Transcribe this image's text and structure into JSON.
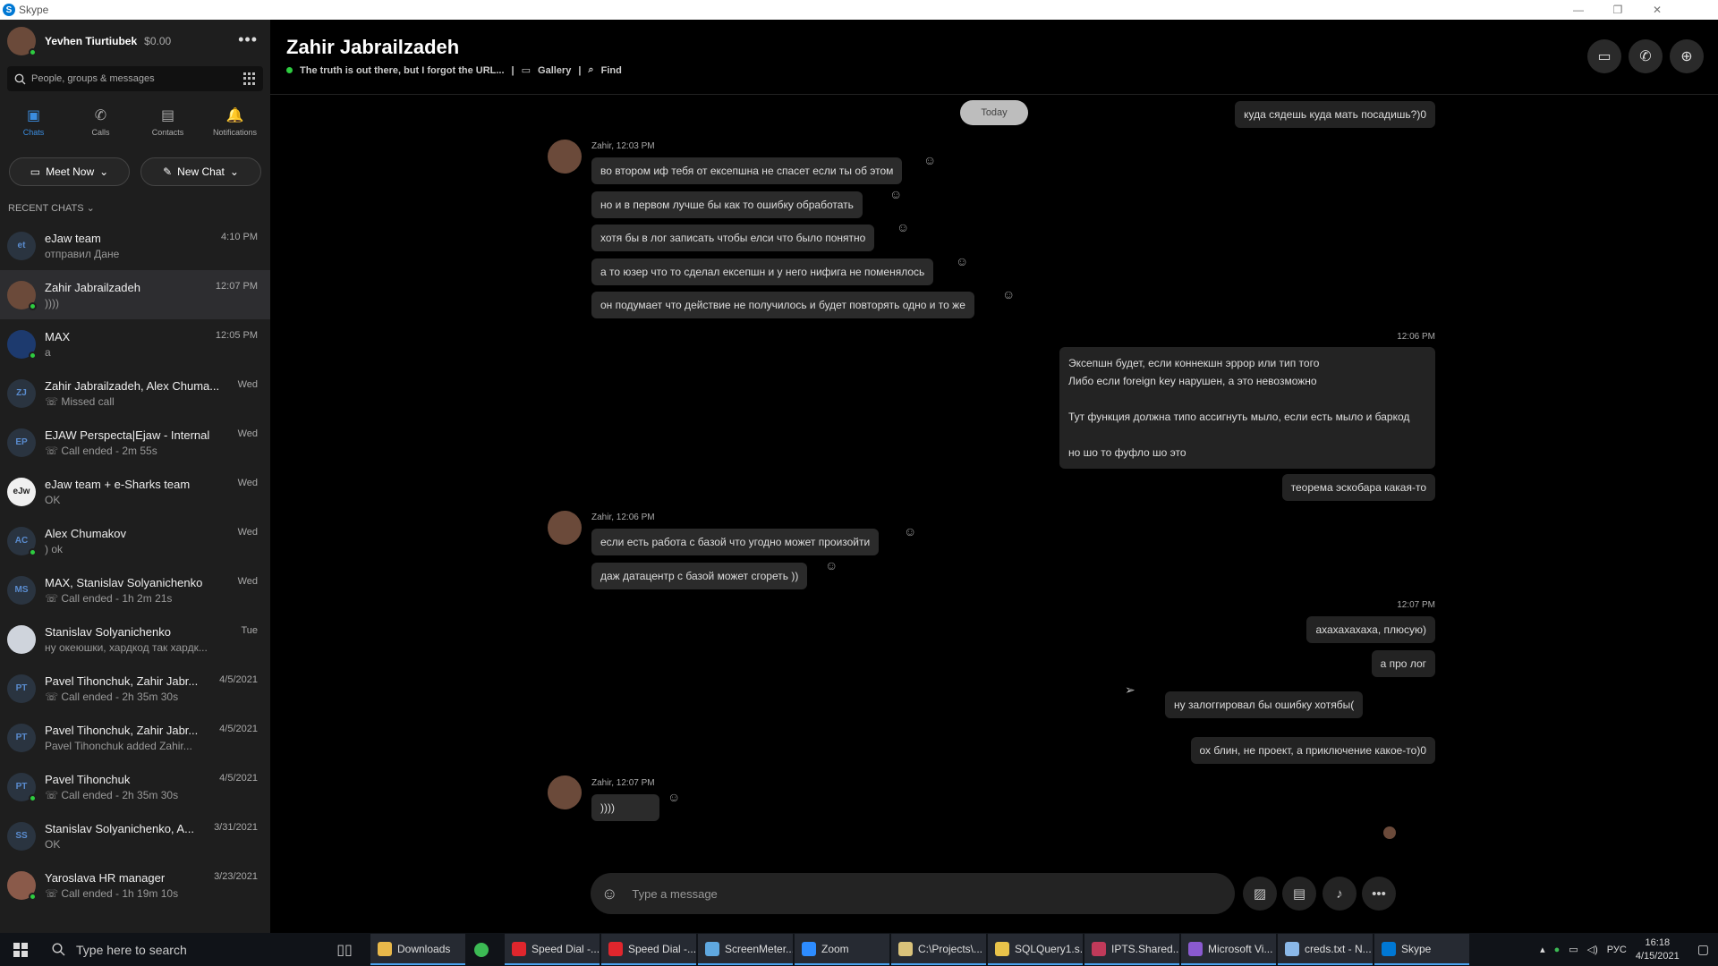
{
  "window": {
    "app_title": "Skype",
    "controls": [
      "—",
      "❐",
      "✕"
    ]
  },
  "profile": {
    "name": "Yevhen Tiurtiubek",
    "credit": "$0.00",
    "more": "•••"
  },
  "search": {
    "placeholder": "People, groups & messages"
  },
  "nav": [
    {
      "label": "Chats",
      "icon": "chat-icon",
      "glyph": "▣"
    },
    {
      "label": "Calls",
      "icon": "phone-icon",
      "glyph": "✆"
    },
    {
      "label": "Contacts",
      "icon": "contacts-icon",
      "glyph": "▤"
    },
    {
      "label": "Notifications",
      "icon": "bell-icon",
      "glyph": "🔔"
    }
  ],
  "actions": {
    "meet_now": "Meet Now",
    "new_chat": "New Chat"
  },
  "recent_header": "RECENT CHATS ⌄",
  "chats": [
    {
      "name": "eJaw team",
      "preview": "отправил Дане",
      "time": "4:10 PM",
      "initials": "et"
    },
    {
      "name": "Zahir Jabrailzadeh",
      "preview": "))))",
      "time": "12:07 PM",
      "initials": ""
    },
    {
      "name": "MAX",
      "preview": "а",
      "time": "12:05 PM",
      "initials": ""
    },
    {
      "name": "Zahir Jabrailzadeh, Alex Chuma...",
      "preview": "☏ Missed call",
      "time": "Wed",
      "initials": "ZJ"
    },
    {
      "name": "EJAW Perspecta|Ejaw - Internal",
      "preview": "☏ Call ended - 2m 55s",
      "time": "Wed",
      "initials": "EP"
    },
    {
      "name": "eJaw team + e-Sharks team",
      "preview": "OK",
      "time": "Wed",
      "initials": "eJw"
    },
    {
      "name": "Alex Chumakov",
      "preview": ") ok",
      "time": "Wed",
      "initials": "AC"
    },
    {
      "name": "MAX, Stanislav Solyanichenko",
      "preview": "☏ Call ended - 1h 2m 21s",
      "time": "Wed",
      "initials": "MS"
    },
    {
      "name": "Stanislav Solyanichenko",
      "preview": "ну океюшки, хардкод так хардк...",
      "time": "Tue",
      "initials": ""
    },
    {
      "name": "Pavel Tihonchuk, Zahir Jabr...",
      "preview": "☏ Call ended - 2h 35m 30s",
      "time": "4/5/2021",
      "initials": "PT"
    },
    {
      "name": "Pavel Tihonchuk, Zahir Jabr...",
      "preview": "Pavel Tihonchuk added Zahir...",
      "time": "4/5/2021",
      "initials": "PT"
    },
    {
      "name": "Pavel Tihonchuk",
      "preview": "☏ Call ended - 2h 35m 30s",
      "time": "4/5/2021",
      "initials": "PT"
    },
    {
      "name": "Stanislav Solyanichenko, A...",
      "preview": "OK",
      "time": "3/31/2021",
      "initials": "SS"
    },
    {
      "name": "Yaroslava HR manager",
      "preview": "☏ Call ended - 1h 19m 10s",
      "time": "3/23/2021",
      "initials": ""
    }
  ],
  "conversation": {
    "title": "Zahir Jabrailzadeh",
    "mood": "The truth is out there, but I forgot the URL...",
    "gallery": "Gallery",
    "find": "Find",
    "today": "Today",
    "top_out": "куда сядешь куда мать посадишь?)0",
    "group1_sender": "Zahir, 12:03 PM",
    "group1": [
      "во втором иф тебя от ексепшна не спасет если ты об этом",
      "но и в первом лучше бы как то ошибку обработать",
      "хотя бы в лог записать чтобы елси что было понятно",
      "а то юзер что то сделал ексепшн и у него нифига не поменялось",
      "он подумает что действие не получилось и будет повторять одно и то же"
    ],
    "out1_time": "12:06 PM",
    "out1_lines": [
      "Эксепшн будет, если коннекшн эррор или тип того",
      "Либо если foreign key нарушен, а это невозможно",
      "",
      "Тут функция должна типо ассигнуть мыло, если есть мыло и баркод",
      "",
      "но шо то фуфло шо это"
    ],
    "out2": "теорема эскобара какая-то",
    "group2_sender": "Zahir, 12:06 PM",
    "group2": [
      "если есть работа с базой что угодно может произойти",
      "даж датацентр с базой может сгореть ))"
    ],
    "out3_time": "12:07 PM",
    "out3": [
      "ахахахахаха, плюсую)",
      "а про лог"
    ],
    "out_pending": "ну залоггировал бы ошибку хотябы(",
    "out4": "ох блин, не проект, а приключение какое-то)0",
    "group3_sender": "Zahir, 12:07 PM",
    "group3": [
      "))))"
    ]
  },
  "composer": {
    "placeholder": "Type a message"
  },
  "taskbar": {
    "search": "Type here to search",
    "apps": [
      {
        "label": "Downloads",
        "color": "#e8b84a",
        "active": true
      },
      {
        "label": "",
        "color": "#3cba54",
        "active": false
      },
      {
        "label": "Speed Dial -...",
        "color": "#e0262d",
        "active": true
      },
      {
        "label": "Speed Dial -...",
        "color": "#e0262d",
        "active": true
      },
      {
        "label": "ScreenMeter...",
        "color": "#5fa8e0",
        "active": true
      },
      {
        "label": "Zoom",
        "color": "#2d8cff",
        "active": true
      },
      {
        "label": "C:\\Projects\\...",
        "color": "#d9c27a",
        "active": true
      },
      {
        "label": "SQLQuery1.s...",
        "color": "#e8c34a",
        "active": true
      },
      {
        "label": "IPTS.Shared....",
        "color": "#c03a5a",
        "active": true
      },
      {
        "label": "Microsoft Vi...",
        "color": "#8a5ad0",
        "active": true
      },
      {
        "label": "creds.txt - N...",
        "color": "#8ab8e8",
        "active": true
      },
      {
        "label": "Skype",
        "color": "#0078d4",
        "active": true
      }
    ],
    "lang": "РУС",
    "time": "16:18",
    "date": "4/15/2021"
  }
}
